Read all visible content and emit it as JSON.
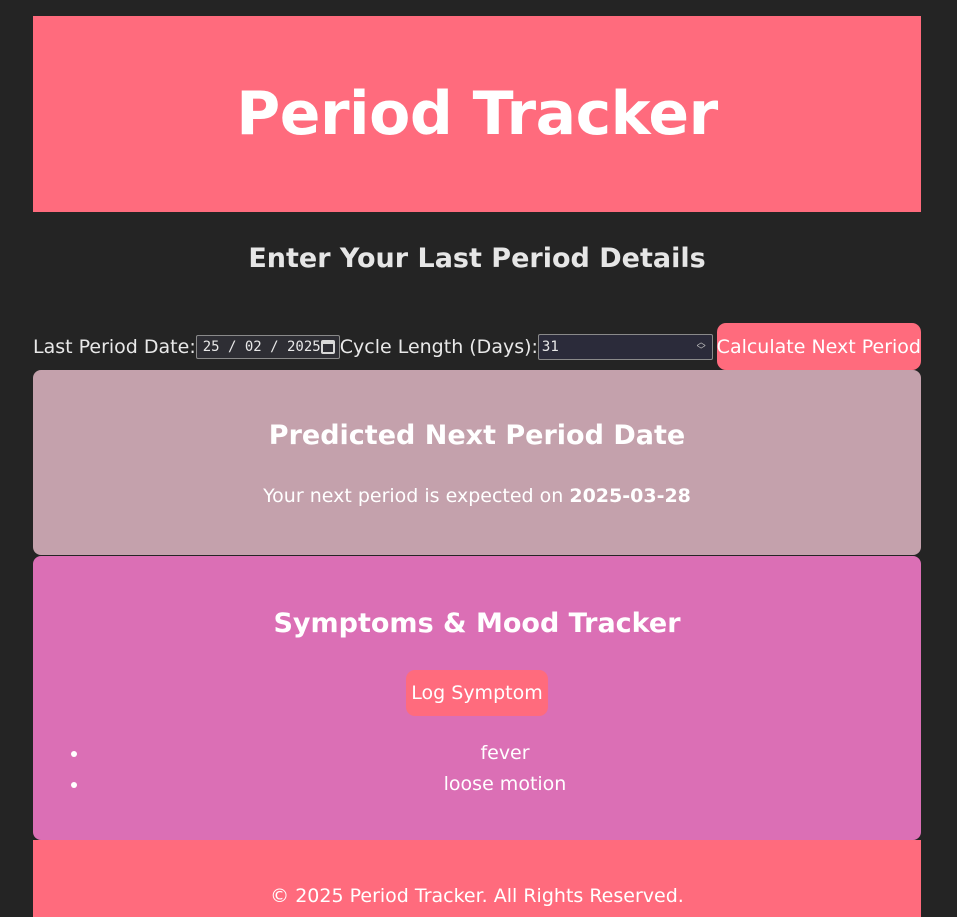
{
  "header": {
    "title": "Period Tracker"
  },
  "form": {
    "section_title": "Enter Your Last Period Details",
    "last_period_label": "Last Period Date:",
    "last_period_value": "25 / 02 / 2025",
    "cycle_length_label": "Cycle Length (Days):",
    "cycle_length_value": "31",
    "calculate_button": "Calculate Next Period"
  },
  "prediction": {
    "title": "Predicted Next Period Date",
    "text": "Your next period is expected on",
    "date": "2025-03-28"
  },
  "symptoms": {
    "title": "Symptoms & Mood Tracker",
    "log_button": "Log Symptom",
    "items": [
      "fever",
      "loose motion"
    ]
  },
  "footer": {
    "text": "© 2025 Period Tracker. All Rights Reserved."
  },
  "colors": {
    "background": "#242424",
    "accent": "#ff6b7d",
    "prediction_bg": "#c4a1ac",
    "symptoms_bg": "#db6fb5"
  },
  "icons": {
    "date_picker": "calendar-icon",
    "number_spinner": "spinner-icon"
  }
}
